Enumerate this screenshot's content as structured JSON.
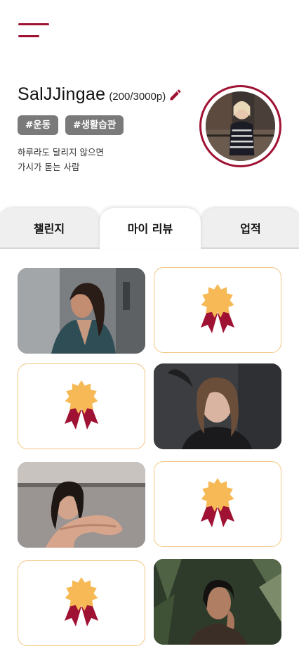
{
  "profile": {
    "username": "SalJJingae",
    "points": "(200/3000p)",
    "tags": [
      "#운동",
      "#생활습관"
    ],
    "bio_line1": "하루라도 달리지 않으면",
    "bio_line2": "가시가 돋는 사람"
  },
  "tabs": [
    "챌린지",
    "마이 리뷰",
    "업적"
  ],
  "active_tab": "마이 리뷰",
  "grid": [
    {
      "type": "photo"
    },
    {
      "type": "badge-icon"
    },
    {
      "type": "badge-icon"
    },
    {
      "type": "photo"
    },
    {
      "type": "photo"
    },
    {
      "type": "badge-icon"
    },
    {
      "type": "badge-icon"
    },
    {
      "type": "photo"
    }
  ],
  "colors": {
    "accent": "#a01233",
    "badge_gold": "#f6b955",
    "tag_bg": "#7a7a7a",
    "card_border": "#f2c783"
  }
}
